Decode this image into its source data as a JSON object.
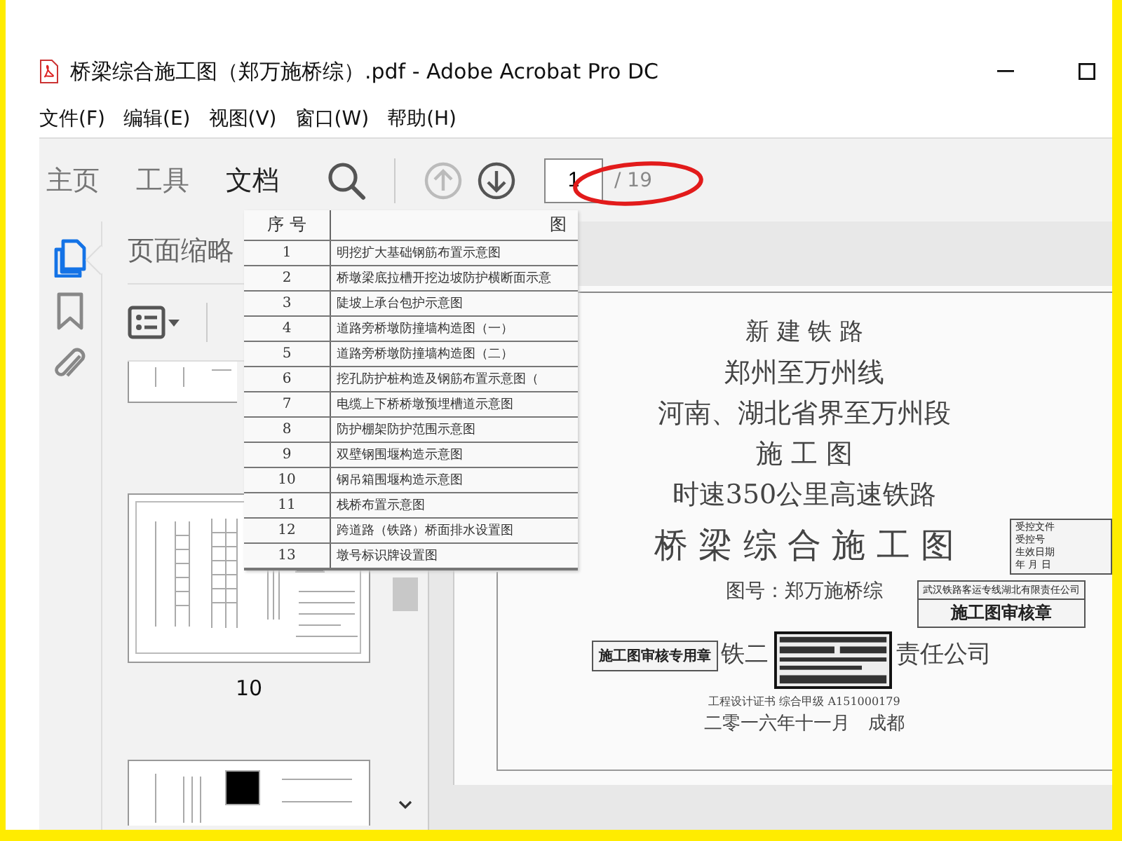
{
  "window": {
    "title": "桥梁综合施工图（郑万施桥综）.pdf - Adobe Acrobat Pro DC"
  },
  "menu": [
    "文件(F)",
    "编辑(E)",
    "视图(V)",
    "窗口(W)",
    "帮助(H)"
  ],
  "toolbar": {
    "tabs": [
      {
        "label": "主页",
        "selected": false
      },
      {
        "label": "工具",
        "selected": false
      },
      {
        "label": "文档",
        "selected": true
      }
    ],
    "nav": [
      {
        "kind": "up",
        "disabled": true
      },
      {
        "kind": "down",
        "disabled": false
      }
    ],
    "page_field": {
      "value": "1"
    },
    "page_total": "/ 19"
  },
  "side_rail": [
    {
      "kind": "pages",
      "selected": true
    },
    {
      "kind": "bookmarks",
      "selected": false
    },
    {
      "kind": "attachments",
      "selected": false
    }
  ],
  "thumbnail_panel": {
    "title": "页面缩略",
    "page_label": "10"
  },
  "overlay_table": {
    "columns": [
      "序 号",
      "图"
    ],
    "rows": [
      [
        "1",
        "明挖扩大基础钢筋布置示意图"
      ],
      [
        "2",
        "桥墩梁底拉槽开挖边坡防护横断面示意"
      ],
      [
        "3",
        "陡坡上承台包护示意图"
      ],
      [
        "4",
        "道路旁桥墩防撞墙构造图（一）"
      ],
      [
        "5",
        "道路旁桥墩防撞墙构造图（二）"
      ],
      [
        "6",
        "挖孔防护桩构造及钢筋布置示意图（"
      ],
      [
        "7",
        "电缆上下桥桥墩预埋槽道示意图"
      ],
      [
        "8",
        "防护棚架防护范围示意图"
      ],
      [
        "9",
        "双壁钢围堰构造示意图"
      ],
      [
        "10",
        "钢吊箱围堰构造示意图"
      ],
      [
        "11",
        "栈桥布置示意图"
      ],
      [
        "12",
        "跨道路（铁路）桥面排水设置图"
      ],
      [
        "13",
        "墩号标识牌设置图"
      ]
    ]
  },
  "cover_page": {
    "lines": [
      {
        "kind": "small-title",
        "parts": [
          "新 建 铁 路"
        ]
      },
      {
        "kind": "title",
        "parts": [
          "郑州至万州线"
        ]
      },
      {
        "kind": "title",
        "parts": [
          "河南、湖北省界至万州段"
        ]
      },
      {
        "kind": "title",
        "parts": [
          "施 工 图"
        ]
      },
      {
        "kind": "title",
        "parts": [
          "时速350公里高速铁路"
        ]
      },
      {
        "kind": "big",
        "parts": [
          "桥 梁 综 合 施 工 图"
        ]
      },
      {
        "kind": "number",
        "parts": [
          "图号：郑万施桥综"
        ]
      },
      {
        "kind": "company",
        "parts": [
          "铁二",
          "责任公司"
        ]
      },
      {
        "kind": "cert",
        "parts": [
          "工程设计证书 综合甲级 A151000179"
        ]
      },
      {
        "kind": "date",
        "parts": [
          "二零一六年十一月　成都"
        ]
      }
    ],
    "stamps": [
      {
        "lines": [
          "受控文件",
          "受控号",
          "生效日期",
          "年 月 日"
        ]
      },
      {
        "lines": [
          "武汉铁路客运专线湖北有限责任公司",
          "施工图审核章"
        ]
      },
      {
        "lines": [
          "施工图审核专用章"
        ]
      }
    ]
  }
}
